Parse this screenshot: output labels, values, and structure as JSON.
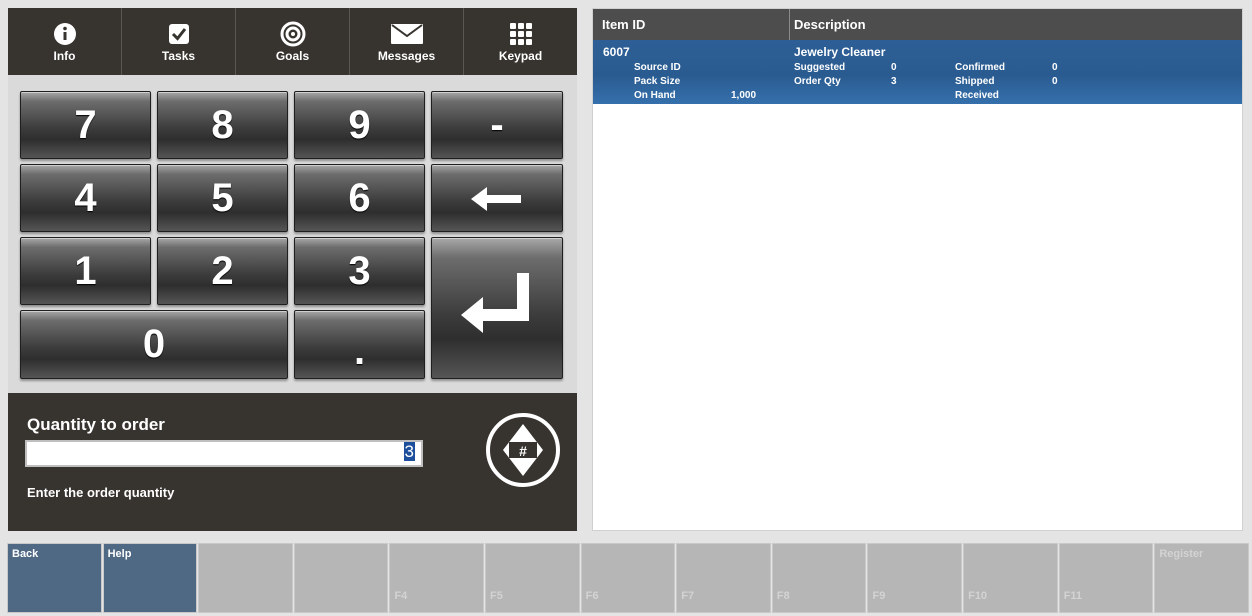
{
  "tabs": [
    {
      "label": "Info",
      "icon": "info-icon"
    },
    {
      "label": "Tasks",
      "icon": "checkbox-icon"
    },
    {
      "label": "Goals",
      "icon": "target-icon"
    },
    {
      "label": "Messages",
      "icon": "envelope-icon"
    },
    {
      "label": "Keypad",
      "icon": "keypad-icon"
    }
  ],
  "keypad": {
    "k7": "7",
    "k8": "8",
    "k9": "9",
    "minus": "-",
    "k4": "4",
    "k5": "5",
    "k6": "6",
    "k1": "1",
    "k2": "2",
    "k3": "3",
    "k0": "0",
    "dot": "."
  },
  "quantity": {
    "title": "Quantity to order",
    "value": "3",
    "hint": "Enter the order quantity",
    "toggle_icon": "#"
  },
  "table": {
    "headers": {
      "item_id": "Item ID",
      "description": "Description"
    },
    "row": {
      "item_id": "6007",
      "description": "Jewelry Cleaner",
      "source_id_label": "Source ID",
      "pack_size_label": "Pack Size",
      "on_hand_label": "On Hand",
      "on_hand_value": "1,000",
      "suggested_label": "Suggested",
      "suggested_value": "0",
      "order_qty_label": "Order Qty",
      "order_qty_value": "3",
      "confirmed_label": "Confirmed",
      "confirmed_value": "0",
      "shipped_label": "Shipped",
      "shipped_value": "0",
      "received_label": "Received"
    }
  },
  "function_keys": [
    {
      "top": "Back",
      "bottom": "",
      "active": true
    },
    {
      "top": "Help",
      "bottom": "",
      "active": true
    },
    {
      "top": "",
      "bottom": "",
      "active": false
    },
    {
      "top": "",
      "bottom": "",
      "active": false
    },
    {
      "top": "",
      "bottom": "F4",
      "active": false
    },
    {
      "top": "",
      "bottom": "F5",
      "active": false
    },
    {
      "top": "",
      "bottom": "F6",
      "active": false
    },
    {
      "top": "",
      "bottom": "F7",
      "active": false
    },
    {
      "top": "",
      "bottom": "F8",
      "active": false
    },
    {
      "top": "",
      "bottom": "F9",
      "active": false
    },
    {
      "top": "",
      "bottom": "F10",
      "active": false
    },
    {
      "top": "",
      "bottom": "F11",
      "active": false
    },
    {
      "top": "Register",
      "bottom": "",
      "active": false
    }
  ],
  "colors": {
    "panel_dark": "#37332f",
    "row_selected": "#2d5f96",
    "fkey_active": "#4f6884",
    "fkey_inactive": "#b6b6b6"
  }
}
